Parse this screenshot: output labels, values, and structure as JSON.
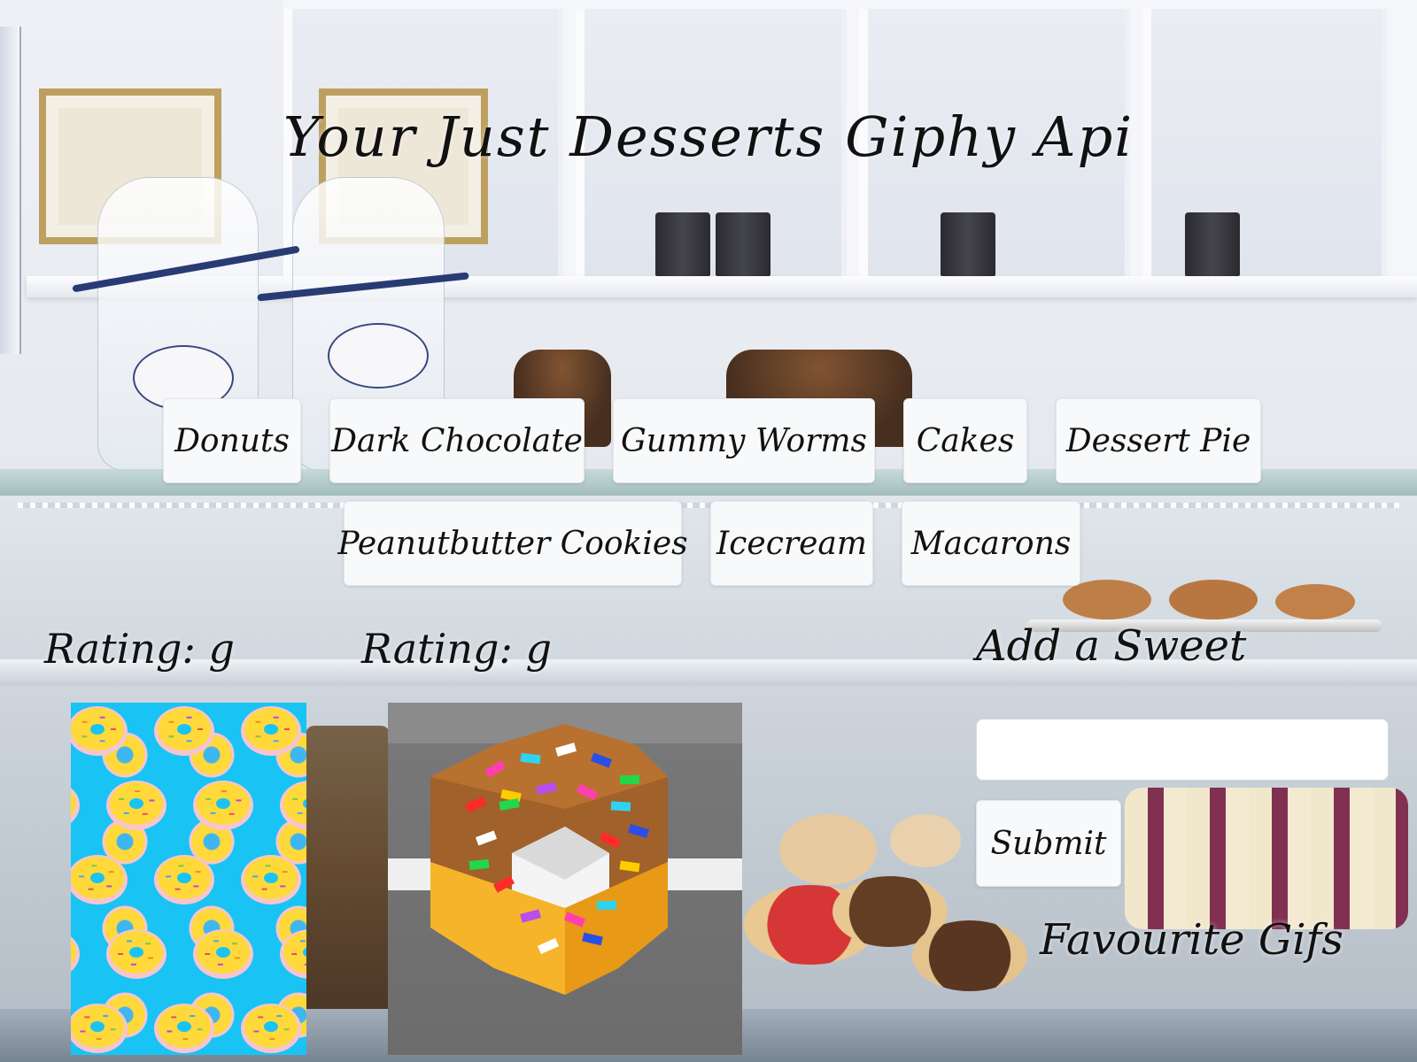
{
  "header": {
    "title": "Your Just Desserts Giphy Api"
  },
  "topics": [
    {
      "label": "Donuts"
    },
    {
      "label": "Dark Chocolate"
    },
    {
      "label": "Gummy Worms"
    },
    {
      "label": "Cakes"
    },
    {
      "label": "Dessert Pie"
    },
    {
      "label": "Peanutbutter Cookies"
    },
    {
      "label": "Icecream"
    },
    {
      "label": "Macarons"
    }
  ],
  "results": [
    {
      "rating": "Rating: g"
    },
    {
      "rating": "Rating: g"
    }
  ],
  "add_form": {
    "heading": "Add a Sweet",
    "input_value": "",
    "submit_label": "Submit"
  },
  "favourites": {
    "heading": "Favourite Gifs"
  },
  "colors": {
    "button_bg": "#f8f9fa",
    "text": "#111111",
    "gif_a_bg": "#19c3f4",
    "donut_yellow": "#ffd93a"
  }
}
